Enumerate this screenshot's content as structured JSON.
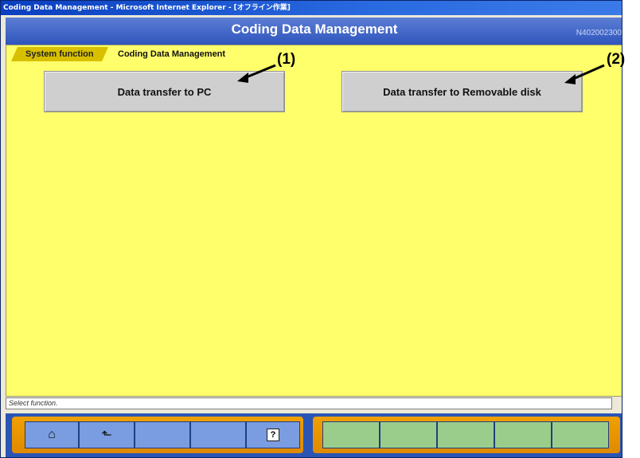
{
  "window": {
    "title": "Coding Data Management - Microsoft Internet Explorer - [オフライン作業]"
  },
  "header": {
    "title": "Coding Data Management",
    "screen_id": "N402002300"
  },
  "breadcrumb": {
    "items": [
      {
        "label": "System function"
      },
      {
        "label": "Coding Data Management"
      }
    ]
  },
  "main": {
    "buttons": [
      {
        "label": "Data transfer to PC"
      },
      {
        "label": "Data transfer to Removable disk"
      }
    ]
  },
  "annotations": {
    "callout_1": "(1)",
    "callout_2": "(2)"
  },
  "status": {
    "text": "Select function."
  },
  "toolbar": {
    "left_icons": [
      "home-icon",
      "back-icon",
      "",
      "",
      "help-icon"
    ],
    "help_label": "?",
    "right_slots": 5
  },
  "colors": {
    "header_blue": "#2f55bd",
    "content_yellow": "#ffff6b",
    "toolbar_orange": "#f0a000",
    "slot_green": "#9acd8c"
  }
}
